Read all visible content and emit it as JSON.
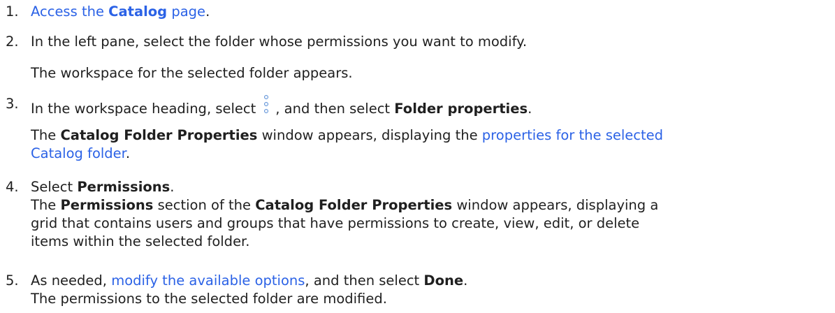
{
  "steps": [
    {
      "number": "1.",
      "link_prefix": "Access the ",
      "link_bold": "Catalog",
      "link_suffix": " page",
      "end": "."
    },
    {
      "number": "2.",
      "text": "In the left pane, select the folder whose permissions you want to modify.",
      "result": "The workspace for the selected folder appears."
    },
    {
      "number": "3.",
      "text_before": "In the workspace heading, select",
      "icon": "more-vertical-icon",
      "text_middle": ", and then select ",
      "bold": "Folder properties",
      "end": ".",
      "result_prefix": "The ",
      "result_bold": "Catalog Folder Properties",
      "result_middle": " window appears, displaying the ",
      "result_link_line1": "properties for the selected",
      "result_link_line2": "Catalog folder",
      "result_end": "."
    },
    {
      "number": "4.",
      "text_before": "Select ",
      "bold": "Permissions",
      "end": ".",
      "result_prefix": "The ",
      "result_bold1": "Permissions",
      "result_middle": " section of the ",
      "result_bold2": "Catalog Folder Properties",
      "result_suffix": " window appears, displaying a",
      "result_line2": "grid that contains users and groups that have permissions to create, view, edit, or delete",
      "result_line3": "items within the selected folder."
    },
    {
      "number": "5.",
      "text_before": "As needed, ",
      "link": "modify the available options",
      "text_middle": ", and then select ",
      "bold": "Done",
      "end": ".",
      "result": "The permissions to the selected folder are modified."
    }
  ],
  "colors": {
    "link": "#2b62e6",
    "text": "#1f1f1f",
    "icon": "#5b8fd6"
  }
}
